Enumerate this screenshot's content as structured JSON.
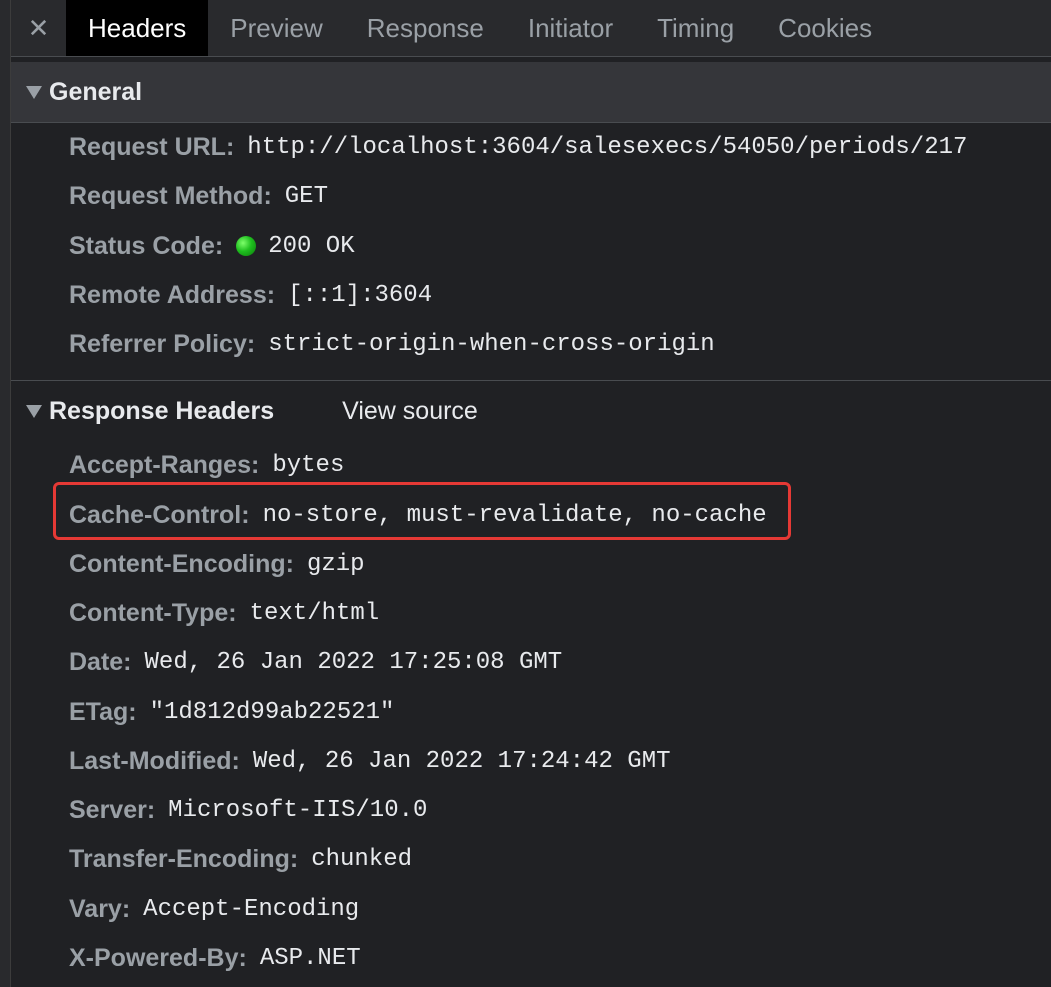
{
  "tabs": {
    "close_glyph": "✕",
    "items": [
      "Headers",
      "Preview",
      "Response",
      "Initiator",
      "Timing",
      "Cookies"
    ],
    "active": "Headers"
  },
  "general": {
    "title": "General",
    "rows": [
      {
        "key": "Request URL:",
        "value": "http://localhost:3604/salesexecs/54050/periods/217"
      },
      {
        "key": "Request Method:",
        "value": "GET"
      },
      {
        "key": "Status Code:",
        "value": "200 OK",
        "status_color": "#1fbf1f"
      },
      {
        "key": "Remote Address:",
        "value": "[::1]:3604"
      },
      {
        "key": "Referrer Policy:",
        "value": "strict-origin-when-cross-origin"
      }
    ]
  },
  "response_headers": {
    "title": "Response Headers",
    "view_source": "View source",
    "highlight_color": "#e53935",
    "highlighted_row": "Cache-Control:",
    "rows": [
      {
        "key": "Accept-Ranges:",
        "value": "bytes"
      },
      {
        "key": "Cache-Control:",
        "value": "no-store, must-revalidate, no-cache"
      },
      {
        "key": "Content-Encoding:",
        "value": "gzip"
      },
      {
        "key": "Content-Type:",
        "value": "text/html"
      },
      {
        "key": "Date:",
        "value": "Wed, 26 Jan 2022 17:25:08 GMT"
      },
      {
        "key": "ETag:",
        "value": "\"1d812d99ab22521\""
      },
      {
        "key": "Last-Modified:",
        "value": "Wed, 26 Jan 2022 17:24:42 GMT"
      },
      {
        "key": "Server:",
        "value": "Microsoft-IIS/10.0"
      },
      {
        "key": "Transfer-Encoding:",
        "value": "chunked"
      },
      {
        "key": "Vary:",
        "value": "Accept-Encoding"
      },
      {
        "key": "X-Powered-By:",
        "value": "ASP.NET"
      }
    ]
  }
}
